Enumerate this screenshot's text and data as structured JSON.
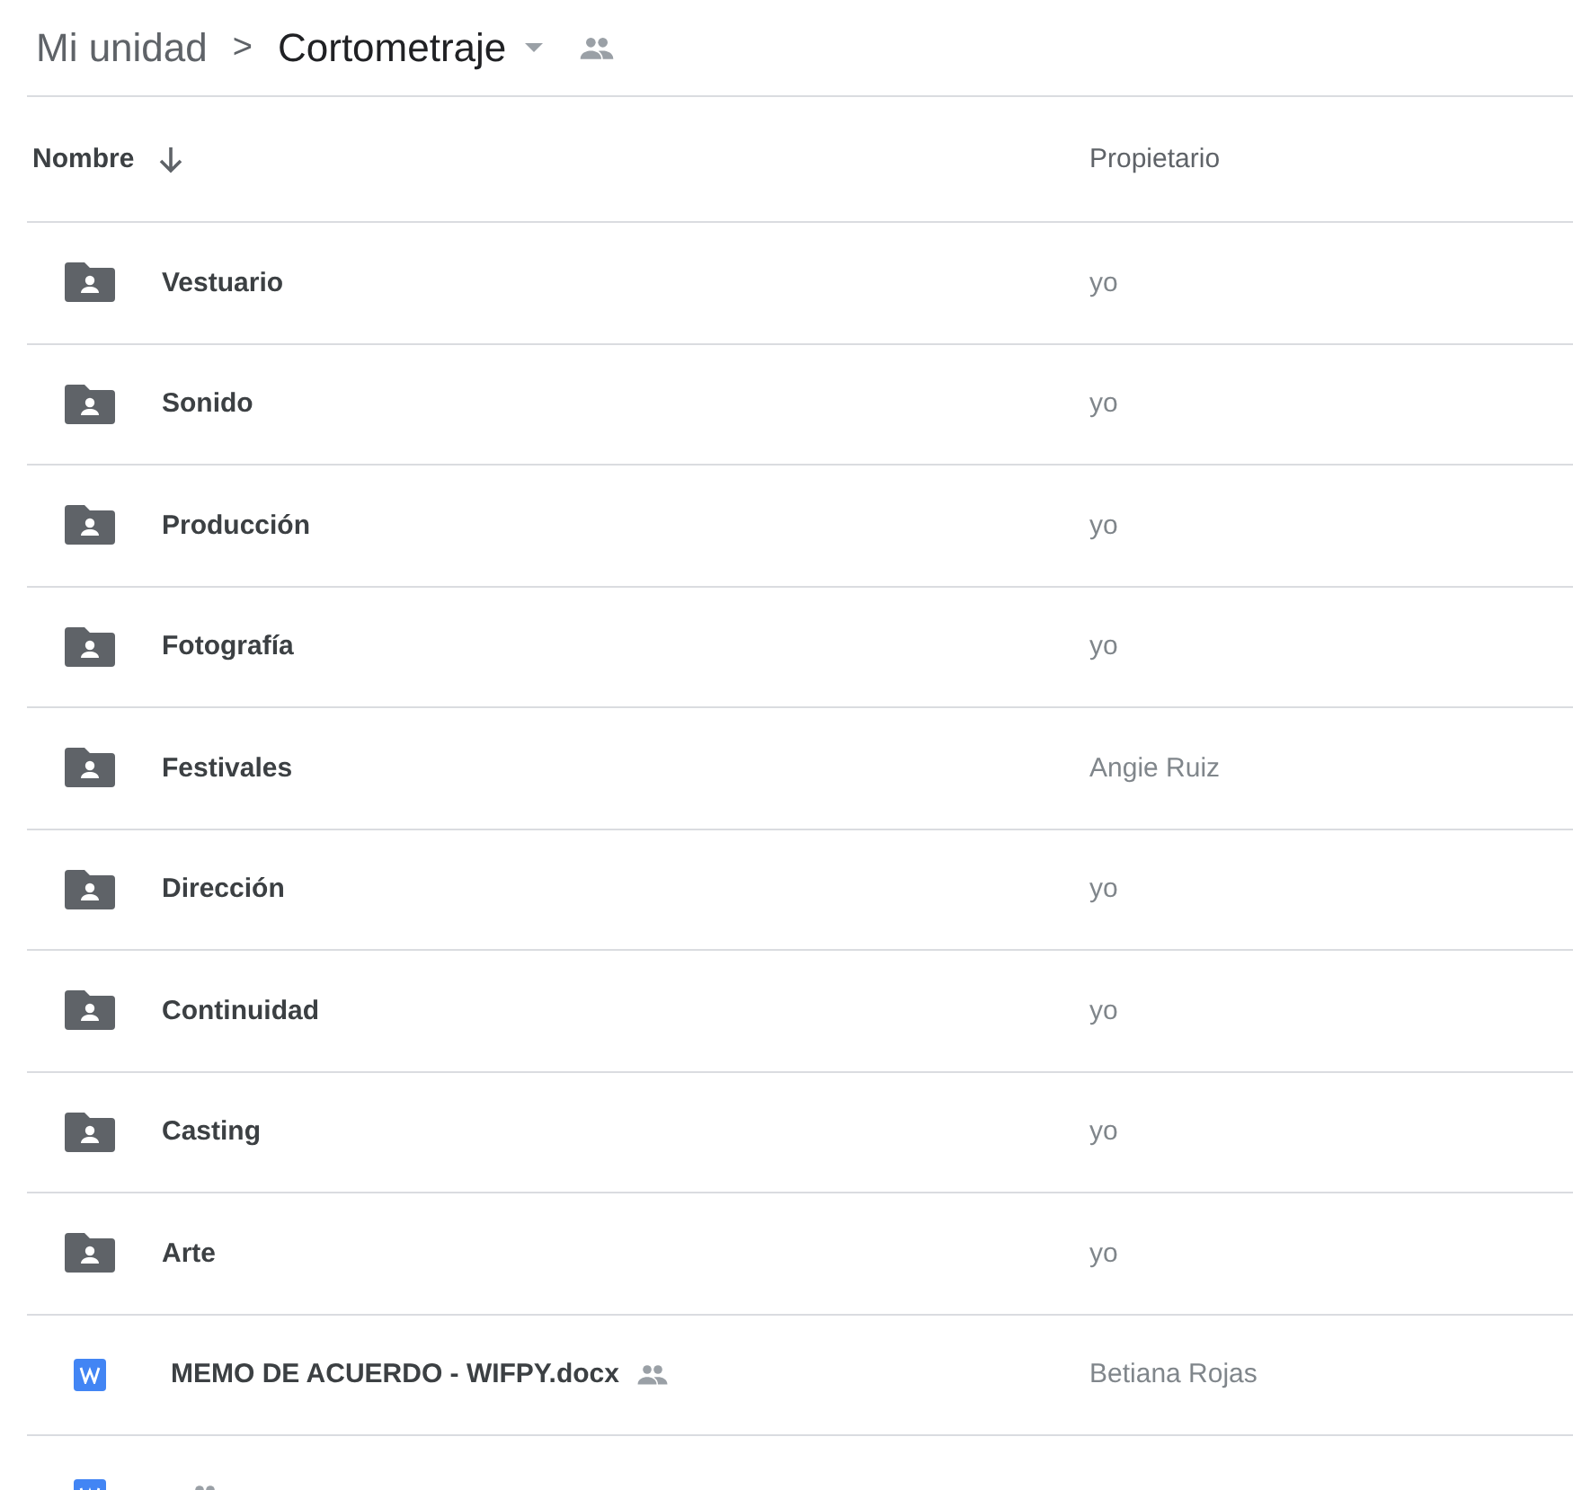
{
  "breadcrumb": {
    "root": "Mi unidad",
    "separator": ">",
    "current": "Cortometraje",
    "shared": true
  },
  "table": {
    "columns": [
      {
        "label": "Nombre",
        "sorted": true
      },
      {
        "label": "Propietario",
        "sorted": false
      }
    ],
    "rows": [
      {
        "kind": "shared-folder",
        "name": "Vestuario",
        "shared": false,
        "owner": "yo"
      },
      {
        "kind": "shared-folder",
        "name": "Sonido",
        "shared": false,
        "owner": "yo"
      },
      {
        "kind": "shared-folder",
        "name": "Producción",
        "shared": false,
        "owner": "yo"
      },
      {
        "kind": "shared-folder",
        "name": "Fotografía",
        "shared": false,
        "owner": "yo"
      },
      {
        "kind": "shared-folder",
        "name": "Festivales",
        "shared": false,
        "owner": "Angie Ruiz"
      },
      {
        "kind": "shared-folder",
        "name": "Dirección",
        "shared": false,
        "owner": "yo"
      },
      {
        "kind": "shared-folder",
        "name": "Continuidad",
        "shared": false,
        "owner": "yo"
      },
      {
        "kind": "shared-folder",
        "name": "Casting",
        "shared": false,
        "owner": "yo"
      },
      {
        "kind": "shared-folder",
        "name": "Arte",
        "shared": false,
        "owner": "yo"
      },
      {
        "kind": "word-doc",
        "name": "MEMO DE ACUERDO - WIFPY.docx",
        "shared": true,
        "owner": "Betiana Rojas"
      },
      {
        "kind": "word-doc",
        "shared": true
      }
    ]
  }
}
